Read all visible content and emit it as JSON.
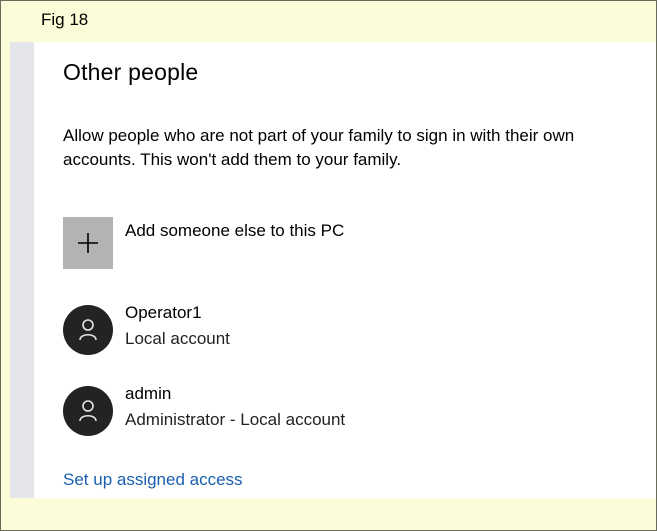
{
  "figure": {
    "label": "Fig 18"
  },
  "settings": {
    "section_title": "Other people",
    "description": "Allow people who are not part of your family to sign in with their own accounts. This won't add them to your family.",
    "add_button": {
      "icon": "plus-icon",
      "label": "Add someone else to this PC"
    },
    "accounts": [
      {
        "icon": "user-icon",
        "name": "Operator1",
        "type": "Local account"
      },
      {
        "icon": "user-icon",
        "name": "admin",
        "type": "Administrator - Local account"
      }
    ],
    "assigned_access_link": "Set up assigned access"
  },
  "colors": {
    "figure_background": "#fdfcd8",
    "sidebar": "#e5e6ec",
    "tile": "#b3b3b3",
    "avatar": "#232323",
    "link": "#1a5fae"
  }
}
